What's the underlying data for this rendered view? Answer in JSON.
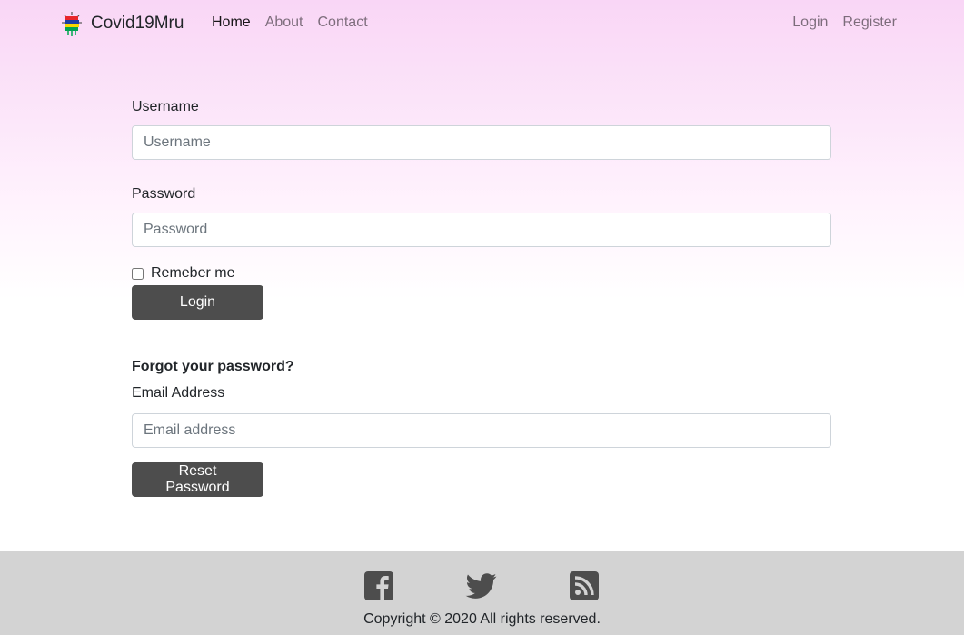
{
  "brand": {
    "name": "Covid19Mru",
    "logo_icon": "mauritius-virus-logo-icon"
  },
  "nav": {
    "left": [
      {
        "label": "Home",
        "active": true
      },
      {
        "label": "About",
        "active": false
      },
      {
        "label": "Contact",
        "active": false
      }
    ],
    "right": [
      {
        "label": "Login"
      },
      {
        "label": "Register"
      }
    ]
  },
  "login_form": {
    "username_label": "Username",
    "username_placeholder": "Username",
    "username_value": "",
    "password_label": "Password",
    "password_placeholder": "Password",
    "password_value": "",
    "remember_label": "Remeber me",
    "remember_checked": false,
    "submit_label": "Login"
  },
  "reset_form": {
    "heading": "Forgot your password?",
    "email_label": "Email Address",
    "email_placeholder": "Email address",
    "email_value": "",
    "submit_label": "Reset Password"
  },
  "footer": {
    "social": [
      {
        "icon": "facebook-icon"
      },
      {
        "icon": "twitter-icon"
      },
      {
        "icon": "rss-icon"
      }
    ],
    "copyright": "Copyright © 2020 All rights reserved."
  },
  "colors": {
    "button": "#4d4d4d",
    "footer_bg": "#d3d3d3",
    "header_gradient_top": "#f9d6f6",
    "social_icon": "#4d4d4d"
  }
}
